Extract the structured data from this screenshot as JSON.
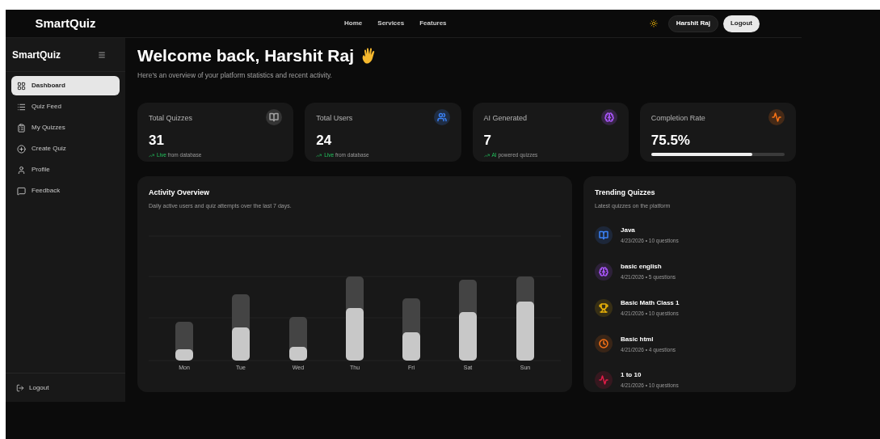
{
  "navbar": {
    "brand": "SmartQuiz",
    "links": [
      "Home",
      "Services",
      "Features"
    ],
    "user": "Harshit Raj",
    "logout": "Logout"
  },
  "sidebar": {
    "brand": "SmartQuiz",
    "items": [
      {
        "label": "Dashboard",
        "selected": true
      },
      {
        "label": "Quiz Feed",
        "selected": false
      },
      {
        "label": "My Quizzes",
        "selected": false
      },
      {
        "label": "Create Quiz",
        "selected": false
      },
      {
        "label": "Profile",
        "selected": false
      },
      {
        "label": "Feedback",
        "selected": false
      }
    ],
    "logout": "Logout"
  },
  "header": {
    "title": "Welcome back, Harshit Raj",
    "subtitle": "Here's an overview of your platform statistics and recent activity."
  },
  "stats": [
    {
      "kind": "count",
      "label": "Total Quizzes",
      "value": "31",
      "highlight": "Live",
      "note": "from database",
      "color": "#a3a3a3"
    },
    {
      "kind": "count",
      "label": "Total Users",
      "value": "24",
      "highlight": "Live",
      "note": "from database",
      "color": "#3b82f6"
    },
    {
      "kind": "count",
      "label": "AI Generated",
      "value": "7",
      "highlight": "AI",
      "note": "powered quizzes",
      "color": "#a855f7"
    },
    {
      "kind": "progress",
      "label": "Completion Rate",
      "value": "75.5%",
      "level": 0.755,
      "color": "#f97316"
    }
  ],
  "activity": {
    "title": "Activity Overview",
    "subtitle": "Daily active users and quiz attempts over the last 7 days.",
    "days": [
      "Mon",
      "Tue",
      "Wed",
      "Thu",
      "Fri",
      "Sat",
      "Sun"
    ]
  },
  "trending": {
    "title": "Trending Quizzes",
    "subtitle": "Latest quizzes on the platform",
    "items": [
      {
        "name": "Java",
        "meta": "4/23/2026 • 10 questions",
        "color": "#3b82f6"
      },
      {
        "name": "basic english",
        "meta": "4/21/2026 • 5 questions",
        "color": "#a855f7"
      },
      {
        "name": "Basic Math Class 1",
        "meta": "4/21/2026 • 10 questions",
        "color": "#eab308"
      },
      {
        "name": "Basic html",
        "meta": "4/21/2026 • 4 questions",
        "color": "#f97316"
      },
      {
        "name": "1 to 10",
        "meta": "4/21/2026 • 10 questions",
        "color": "#e11d48"
      }
    ]
  }
}
